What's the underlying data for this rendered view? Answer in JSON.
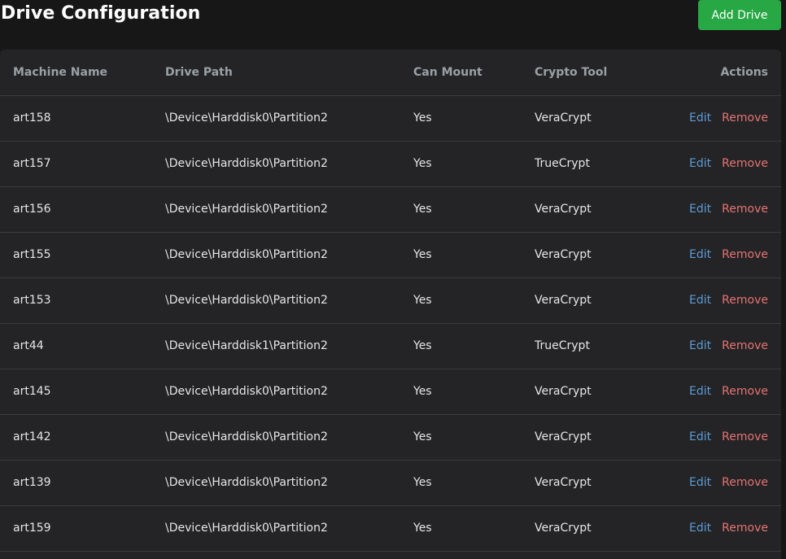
{
  "header": {
    "title": "Drive Configuration",
    "add_button_label": "Add Drive"
  },
  "table": {
    "columns": [
      "Machine Name",
      "Drive Path",
      "Can Mount",
      "Crypto Tool",
      "Actions"
    ],
    "rows": [
      {
        "machine": "art158",
        "path": "\\Device\\Harddisk0\\Partition2",
        "can_mount": "Yes",
        "crypto_tool": "VeraCrypt",
        "edit_label": "Edit",
        "remove_label": "Remove"
      },
      {
        "machine": "art157",
        "path": "\\Device\\Harddisk0\\Partition2",
        "can_mount": "Yes",
        "crypto_tool": "TrueCrypt",
        "edit_label": "Edit",
        "remove_label": "Remove"
      },
      {
        "machine": "art156",
        "path": "\\Device\\Harddisk0\\Partition2",
        "can_mount": "Yes",
        "crypto_tool": "VeraCrypt",
        "edit_label": "Edit",
        "remove_label": "Remove"
      },
      {
        "machine": "art155",
        "path": "\\Device\\Harddisk0\\Partition2",
        "can_mount": "Yes",
        "crypto_tool": "VeraCrypt",
        "edit_label": "Edit",
        "remove_label": "Remove"
      },
      {
        "machine": "art153",
        "path": "\\Device\\Harddisk0\\Partition2",
        "can_mount": "Yes",
        "crypto_tool": "VeraCrypt",
        "edit_label": "Edit",
        "remove_label": "Remove"
      },
      {
        "machine": "art44",
        "path": "\\Device\\Harddisk1\\Partition2",
        "can_mount": "Yes",
        "crypto_tool": "TrueCrypt",
        "edit_label": "Edit",
        "remove_label": "Remove"
      },
      {
        "machine": "art145",
        "path": "\\Device\\Harddisk0\\Partition2",
        "can_mount": "Yes",
        "crypto_tool": "VeraCrypt",
        "edit_label": "Edit",
        "remove_label": "Remove"
      },
      {
        "machine": "art142",
        "path": "\\Device\\Harddisk0\\Partition2",
        "can_mount": "Yes",
        "crypto_tool": "VeraCrypt",
        "edit_label": "Edit",
        "remove_label": "Remove"
      },
      {
        "machine": "art139",
        "path": "\\Device\\Harddisk0\\Partition2",
        "can_mount": "Yes",
        "crypto_tool": "VeraCrypt",
        "edit_label": "Edit",
        "remove_label": "Remove"
      },
      {
        "machine": "art159",
        "path": "\\Device\\Harddisk0\\Partition2",
        "can_mount": "Yes",
        "crypto_tool": "VeraCrypt",
        "edit_label": "Edit",
        "remove_label": "Remove"
      }
    ]
  },
  "colors": {
    "background": "#171717",
    "card": "#242426",
    "add_button": "#28a745",
    "edit_link": "#5b9bd5",
    "remove_link": "#e57373",
    "header_text": "#9aa0a6"
  }
}
